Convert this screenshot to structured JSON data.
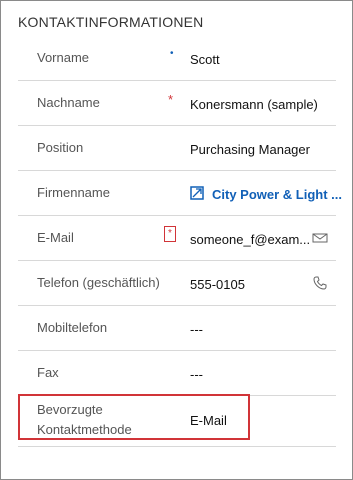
{
  "section": {
    "title": "KONTAKTINFORMATIONEN"
  },
  "fields": {
    "vorname": {
      "label": "Vorname",
      "value": "Scott",
      "required_marker": "•"
    },
    "nachname": {
      "label": "Nachname",
      "value": "Konersmann (sample)",
      "required_marker": "*"
    },
    "position": {
      "label": "Position",
      "value": "Purchasing Manager"
    },
    "firmenname": {
      "label": "Firmenname",
      "value": "City Power & Light ...",
      "icon": "account-link-icon"
    },
    "email": {
      "label": "E-Mail",
      "value": "someone_f@exam...",
      "required_marker": "*",
      "icon": "email-icon"
    },
    "telefon": {
      "label": "Telefon (geschäftlich)",
      "value": "555-0105",
      "icon": "phone-icon"
    },
    "mobiltelefon": {
      "label": "Mobiltelefon",
      "value": "---"
    },
    "fax": {
      "label": "Fax",
      "value": "---"
    },
    "kontaktmethode": {
      "label_line1": "Bevorzugte",
      "label_line2": "Kontaktmethode",
      "value": "E-Mail"
    }
  },
  "colors": {
    "required_red": "#d13438",
    "recommended_blue": "#1160b7",
    "link_blue": "#1160b7",
    "divider": "#d8d8d8"
  }
}
